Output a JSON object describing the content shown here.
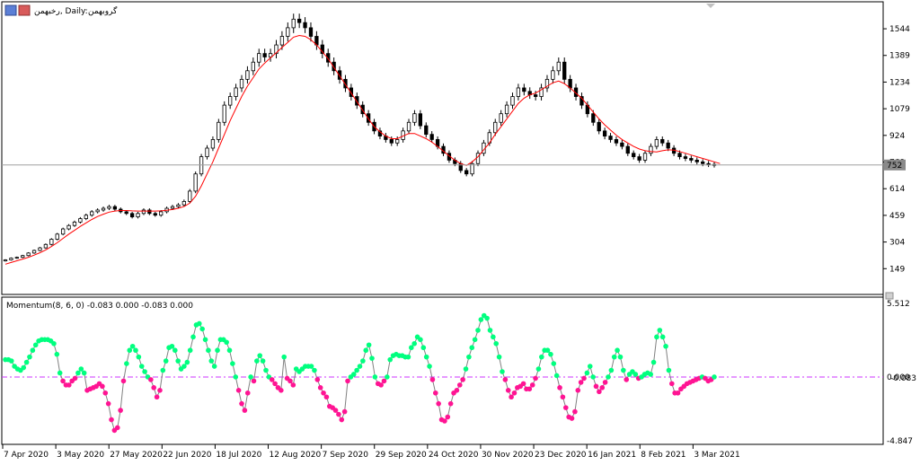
{
  "window": {
    "symbol_label": "گروبهمن",
    "timeframe_label": "رخبهمن, Daily:",
    "current_price_label": "752"
  },
  "indicator": {
    "title": "Momentum(8, 6, 0) -0.083 0.000 -0.083 0.000",
    "top_label": "5.512",
    "bottom_label": "-4.847",
    "zero_label_a": "0.000",
    "zero_label_b": "-0.083"
  },
  "colors": {
    "background": "#ffffff",
    "candle_up": "#ffffff",
    "candle_down": "#000000",
    "ma_line": "#ff0000",
    "momentum_positive": "#00ff7f",
    "momentum_negative": "#ff1493",
    "zero_line": "#cc33ff",
    "grid_line": "#c0c0c0"
  },
  "chart_data": [
    {
      "type": "candlestick",
      "title": "",
      "y_ticks": [
        149,
        304,
        459,
        614,
        769,
        924,
        1079,
        1234,
        1389,
        1544
      ],
      "y_tick_labels": [
        "149",
        "304",
        "459",
        "614",
        "769",
        "924",
        "1079",
        "1234",
        "1389",
        "1544"
      ],
      "ylim": [
        20,
        1680
      ],
      "current_price": 752,
      "x_tick_labels": [
        "7 Apr 2020",
        "3 May 2020",
        "27 May 2020",
        "22 Jun 2020",
        "18 Jul 2020",
        "12 Aug 2020",
        "7 Sep 2020",
        "29 Sep 2020",
        "24 Oct 2020",
        "30 Nov 2020",
        "23 Dec 2020",
        "16 Jan 2021",
        "8 Feb 2021",
        "3 Mar 2021"
      ],
      "close": [
        200,
        210,
        215,
        225,
        240,
        255,
        270,
        290,
        320,
        350,
        380,
        400,
        420,
        440,
        460,
        480,
        490,
        500,
        510,
        495,
        480,
        470,
        450,
        470,
        490,
        470,
        460,
        480,
        500,
        510,
        520,
        540,
        600,
        700,
        800,
        850,
        900,
        1000,
        1100,
        1150,
        1200,
        1250,
        1300,
        1350,
        1400,
        1380,
        1400,
        1450,
        1500,
        1550,
        1600,
        1580,
        1550,
        1500,
        1450,
        1400,
        1350,
        1300,
        1250,
        1200,
        1150,
        1100,
        1050,
        1000,
        950,
        920,
        900,
        880,
        900,
        950,
        1000,
        1050,
        980,
        930,
        900,
        860,
        820,
        780,
        760,
        720,
        700,
        760,
        820,
        880,
        940,
        1000,
        1050,
        1100,
        1150,
        1200,
        1180,
        1160,
        1150,
        1200,
        1250,
        1300,
        1350,
        1250,
        1200,
        1150,
        1100,
        1050,
        1000,
        950,
        920,
        900,
        880,
        860,
        820,
        800,
        780,
        820,
        860,
        900,
        880,
        850,
        820,
        800,
        790,
        780,
        770,
        760,
        755,
        752
      ],
      "ma": [
        175,
        185,
        195,
        205,
        215,
        228,
        242,
        258,
        278,
        300,
        325,
        350,
        372,
        395,
        415,
        435,
        452,
        466,
        478,
        484,
        487,
        487,
        485,
        484,
        484,
        484,
        484,
        485,
        488,
        493,
        500,
        510,
        530,
        570,
        630,
        700,
        770,
        850,
        930,
        1010,
        1080,
        1150,
        1210,
        1260,
        1310,
        1345,
        1375,
        1405,
        1435,
        1465,
        1495,
        1505,
        1500,
        1480,
        1450,
        1410,
        1370,
        1320,
        1270,
        1220,
        1170,
        1120,
        1070,
        1020,
        975,
        945,
        920,
        905,
        905,
        920,
        935,
        935,
        920,
        905,
        885,
        860,
        832,
        805,
        780,
        760,
        750,
        770,
        800,
        840,
        880,
        930,
        975,
        1020,
        1065,
        1110,
        1140,
        1160,
        1170,
        1190,
        1210,
        1230,
        1240,
        1225,
        1200,
        1170,
        1140,
        1100,
        1060,
        1020,
        985,
        955,
        925,
        900,
        880,
        860,
        845,
        835,
        830,
        828,
        835,
        840,
        838,
        830,
        820,
        810,
        800,
        790,
        780,
        770,
        760
      ]
    },
    {
      "type": "scatter",
      "title": "Momentum(8, 6, 0) -0.083 0.000 -0.083 0.000",
      "ylim": [
        -4.847,
        5.512
      ],
      "y_tick_labels": [
        "5.512",
        "0.000",
        "-0.083",
        "-4.847"
      ],
      "values": [
        1.3,
        1.3,
        1.2,
        0.8,
        0.6,
        0.5,
        0.7,
        1.1,
        1.5,
        2.0,
        2.4,
        2.7,
        2.8,
        2.8,
        2.8,
        2.7,
        2.5,
        1.7,
        0.3,
        -0.3,
        -0.6,
        -0.6,
        -0.3,
        -0.1,
        0.3,
        0.6,
        0.3,
        -1.0,
        -0.9,
        -0.8,
        -0.7,
        -0.5,
        -0.7,
        -1.2,
        -2.0,
        -3.2,
        -4.0,
        -3.8,
        -2.5,
        -0.3,
        1.0,
        2.0,
        2.3,
        2.0,
        1.5,
        0.8,
        0.4,
        0.0,
        -0.2,
        -0.8,
        -1.5,
        -1.0,
        0.5,
        1.2,
        2.2,
        2.3,
        2.0,
        1.2,
        0.6,
        0.8,
        1.1,
        2.0,
        3.0,
        3.9,
        4.0,
        3.6,
        2.8,
        2.0,
        1.2,
        0.8,
        2.0,
        2.8,
        2.8,
        2.6,
        2.0,
        1.0,
        0.0,
        -1.0,
        -2.0,
        -2.5,
        -1.2,
        0.0,
        -0.3,
        1.2,
        1.6,
        1.2,
        0.5,
        0.0,
        -0.2,
        -0.5,
        -0.8,
        -1.0,
        1.5,
        -0.1,
        -0.3,
        -0.6,
        0.6,
        0.4,
        0.6,
        0.8,
        0.8,
        0.8,
        0.5,
        -0.2,
        -0.8,
        -1.2,
        -1.5,
        -2.2,
        -2.3,
        -2.5,
        -2.8,
        -3.2,
        -2.6,
        -0.3,
        0.0,
        0.2,
        0.5,
        0.8,
        1.2,
        2.0,
        2.4,
        1.4,
        0.0,
        -0.5,
        -0.6,
        -0.3,
        0.0,
        1.3,
        1.6,
        1.7,
        1.6,
        1.6,
        1.5,
        1.5,
        2.2,
        2.5,
        3.0,
        2.8,
        2.2,
        1.5,
        0.8,
        -0.2,
        -1.2,
        -2.0,
        -3.2,
        -3.3,
        -3.0,
        -2.0,
        -1.2,
        -1.0,
        -0.6,
        -0.2,
        0.6,
        1.5,
        2.2,
        2.8,
        3.5,
        4.3,
        4.6,
        4.4,
        3.5,
        3.0,
        2.5,
        1.5,
        0.4,
        -0.2,
        -1.0,
        -1.5,
        -1.2,
        -0.8,
        -0.7,
        -0.5,
        -0.9,
        -0.9,
        -0.6,
        -0.1,
        0.6,
        1.5,
        2.0,
        2.0,
        1.7,
        1.0,
        0.1,
        -0.8,
        -1.5,
        -2.3,
        -3.0,
        -3.1,
        -2.6,
        -1.0,
        -0.4,
        -0.1,
        0.3,
        0.8,
        0.0,
        -0.7,
        -1.1,
        -0.8,
        -0.4,
        0.0,
        0.5,
        1.5,
        2.0,
        1.5,
        0.5,
        -0.2,
        0.2,
        0.4,
        0.2,
        -0.1,
        0.0,
        0.2,
        0.3,
        0.2,
        1.1,
        3.0,
        3.5,
        3.0,
        2.3,
        0.5,
        -0.5,
        -1.2,
        -1.2,
        -0.9,
        -0.7,
        -0.5,
        -0.4,
        -0.3,
        -0.2,
        -0.1,
        0.0,
        -0.1,
        -0.3,
        -0.2,
        0.0
      ]
    }
  ]
}
